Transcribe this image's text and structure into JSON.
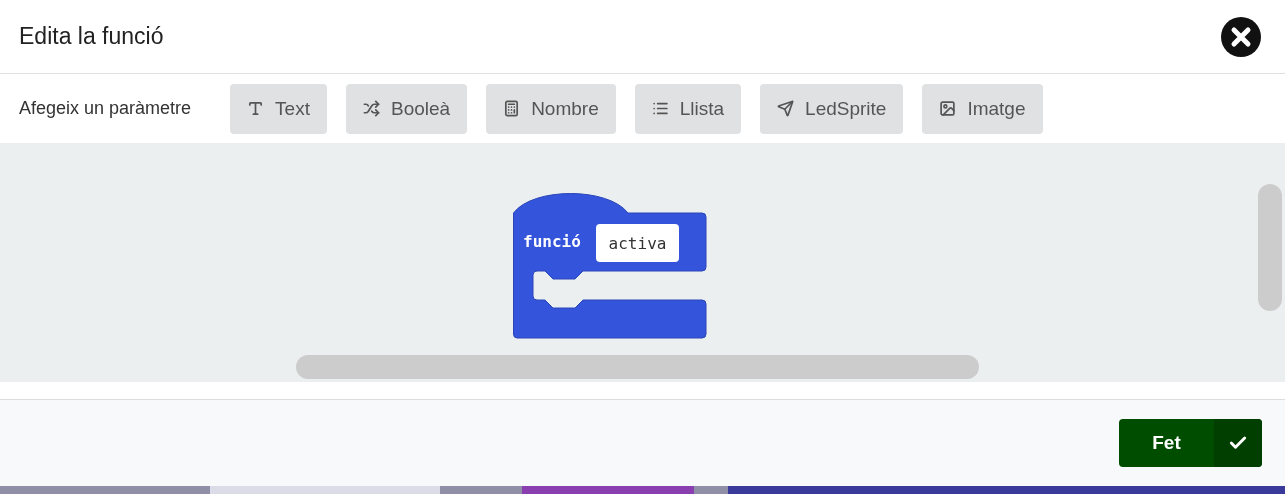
{
  "dialog": {
    "title": "Edita la funció"
  },
  "parameters": {
    "label": "Afegeix un paràmetre",
    "buttons": [
      {
        "kind": "text",
        "label": "Text"
      },
      {
        "kind": "boolean",
        "label": "Booleà"
      },
      {
        "kind": "number",
        "label": "Nombre"
      },
      {
        "kind": "list",
        "label": "Llista"
      },
      {
        "kind": "sprite",
        "label": "LedSprite"
      },
      {
        "kind": "image",
        "label": "Imatge"
      }
    ]
  },
  "block": {
    "keyword": "funció",
    "name": "activa"
  },
  "footer": {
    "done_button": "Fet"
  }
}
